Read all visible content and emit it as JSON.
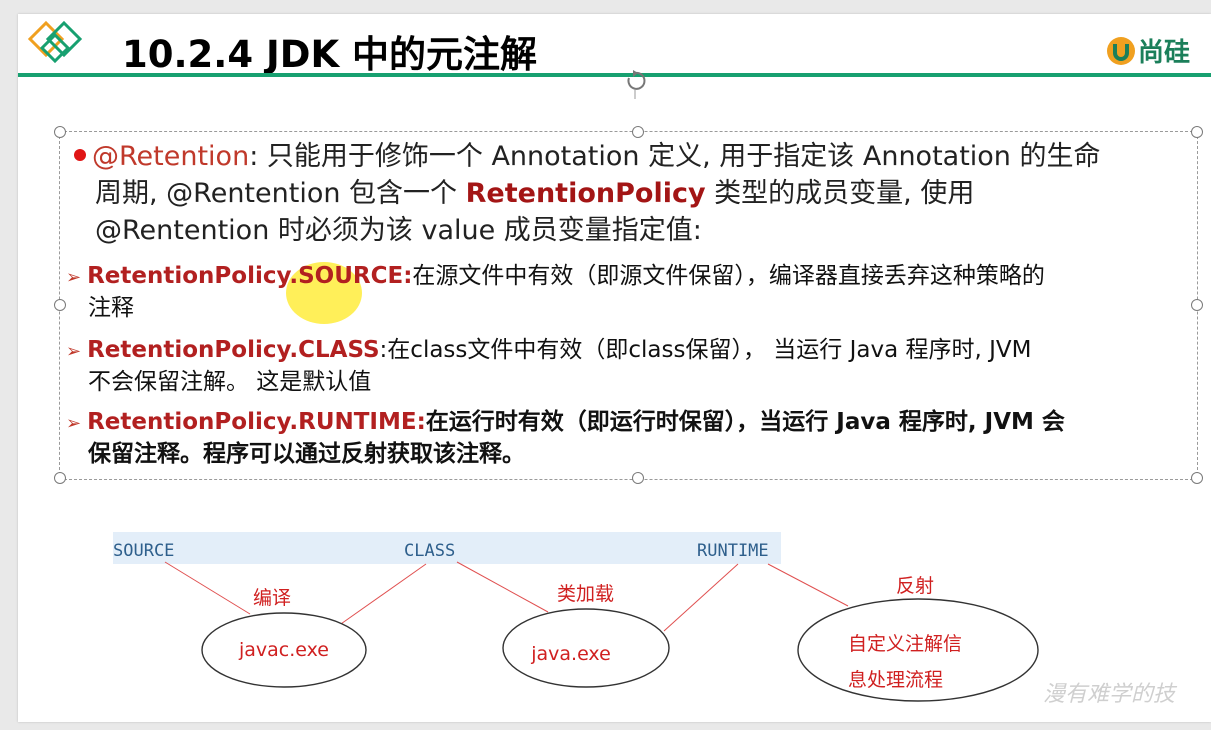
{
  "title": "10.2.4 JDK 中的元注解",
  "brand": "尚硅",
  "intro": {
    "annotation": "@Retention",
    "text1": ": 只能用于修饰一个 Annotation 定义, 用于指定该 Annotation 的生命",
    "text2a": "周期, @Rentention 包含一个 ",
    "policy_type": "RetentionPolicy",
    "text2b": " 类型的成员变量, 使用",
    "text3": "@Rentention 时必须为该 value 成员变量指定值:"
  },
  "policies": [
    {
      "name": "RetentionPolicy.SOURCE:",
      "desc1": "在源文件中有效（即源文件保留），编译器直接丢弃这种策略的",
      "desc2": "注释"
    },
    {
      "name": "RetentionPolicy.CLASS",
      "desc1": ":在class文件中有效（即class保留）， 当运行 Java 程序时, JVM",
      "desc2": "不会保留注解。 这是默认值"
    },
    {
      "name": "RetentionPolicy.RUNTIME:",
      "desc1": "在运行时有效（即运行时保留），当运行 Java 程序时, JVM 会",
      "desc2": "保留注释。程序可以通过反射获取该注释。"
    }
  ],
  "diagram": {
    "stages": [
      "SOURCE",
      "CLASS",
      "RUNTIME"
    ],
    "transitions": [
      "编译",
      "类加载",
      "反射"
    ],
    "nodes": [
      "javac.exe",
      "java.exe",
      "自定义注解信",
      "息处理流程"
    ]
  },
  "watermark": "漫有难学的技",
  "colors": {
    "title_line": "#17a070",
    "policy": "#b22020",
    "bullet": "#e01515",
    "stage_label": "#2e5f8c",
    "diagram_text": "#d02020"
  }
}
